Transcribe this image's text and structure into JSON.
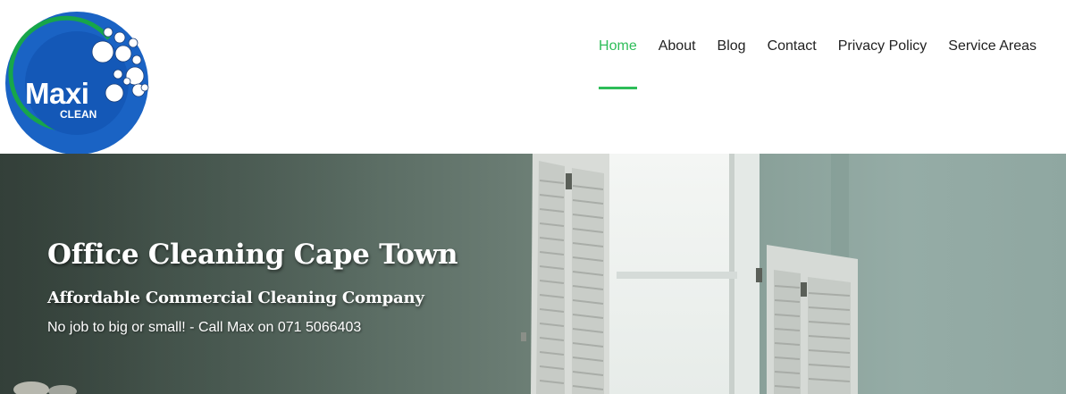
{
  "logo": {
    "main_text": "Maxi",
    "sub_text": "CLEAN",
    "colors": {
      "circle": "#1a63c4",
      "ring": "#17a64a",
      "bubbles": "#ffffff"
    }
  },
  "nav": {
    "items": [
      {
        "label": "Home",
        "active": true
      },
      {
        "label": "About",
        "active": false
      },
      {
        "label": "Blog",
        "active": false
      },
      {
        "label": "Contact",
        "active": false
      },
      {
        "label": "Privacy Policy",
        "active": false
      },
      {
        "label": "Service Areas",
        "active": false
      }
    ],
    "accent_color": "#2ebd59"
  },
  "hero": {
    "title": "Office Cleaning Cape Town",
    "subtitle": "Affordable Commercial Cleaning Company",
    "tagline": "No job to big or small! - Call Max on 071 5066403"
  }
}
